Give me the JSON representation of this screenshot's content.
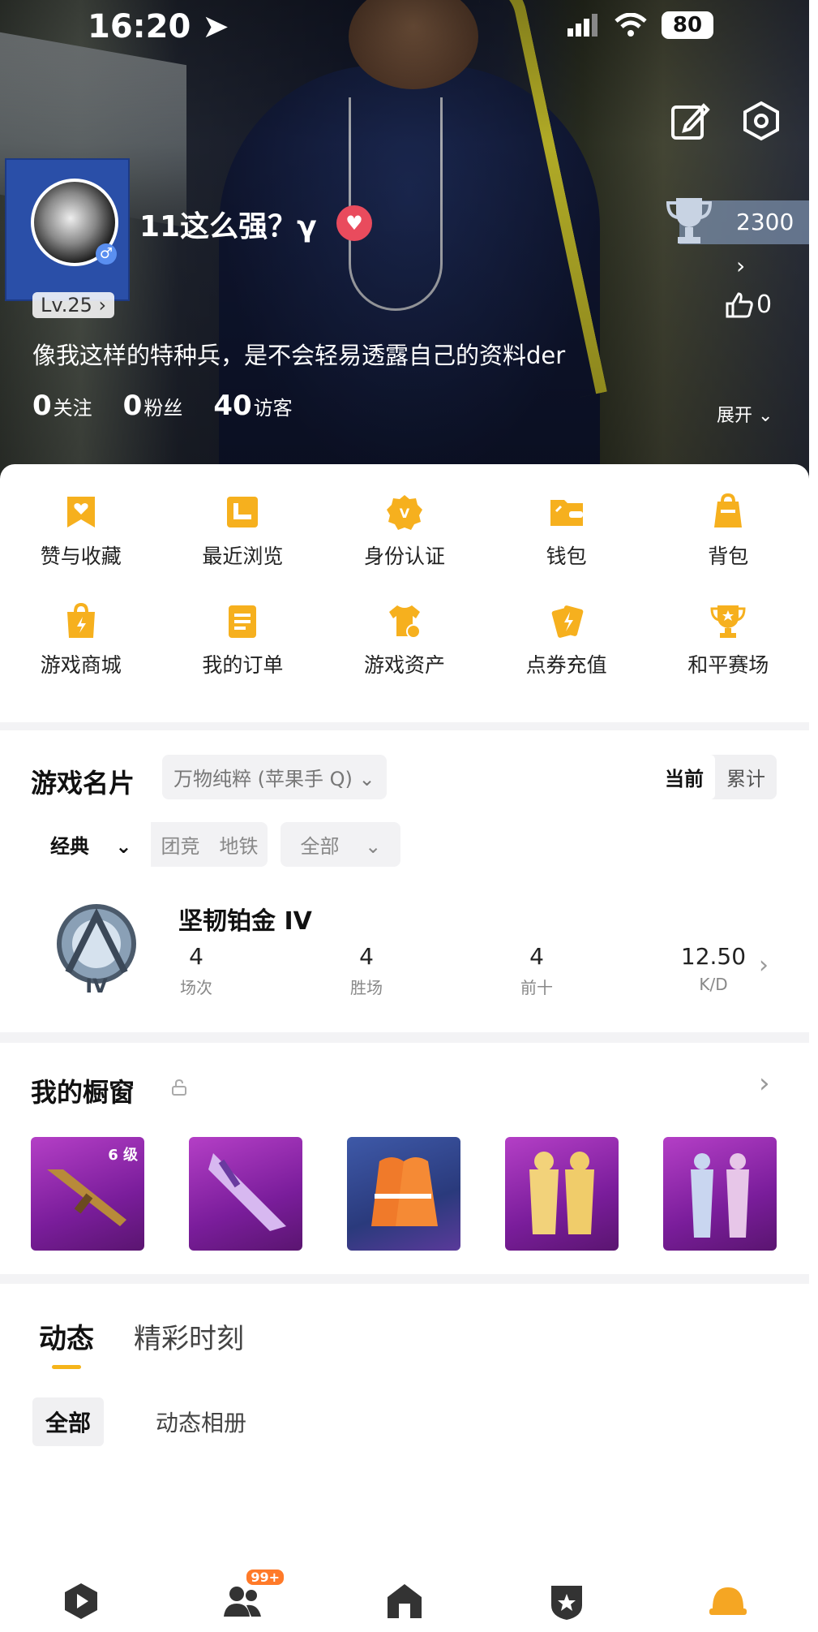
{
  "status_bar": {
    "time": "16:20",
    "battery": "80"
  },
  "profile": {
    "username": "11这么强？γ",
    "level": "Lv.25",
    "bio": "像我这样的特种兵，是不会轻易透露自己的资料der",
    "stats": [
      {
        "value": "0",
        "label": "关注"
      },
      {
        "value": "0",
        "label": "粉丝"
      },
      {
        "value": "40",
        "label": "访客"
      }
    ],
    "expand_label": "展开",
    "trophy_score": "2300",
    "likes": "0"
  },
  "menu": {
    "items": [
      {
        "label": "赞与收藏",
        "icon": "heart-bookmark-icon"
      },
      {
        "label": "最近浏览",
        "icon": "recent-browse-icon"
      },
      {
        "label": "身份认证",
        "icon": "verify-badge-icon"
      },
      {
        "label": "钱包",
        "icon": "wallet-icon"
      },
      {
        "label": "背包",
        "icon": "backpack-icon"
      },
      {
        "label": "游戏商城",
        "icon": "shopping-bag-icon"
      },
      {
        "label": "我的订单",
        "icon": "order-list-icon"
      },
      {
        "label": "游戏资产",
        "icon": "shirt-coin-icon"
      },
      {
        "label": "点券充值",
        "icon": "voucher-recharge-icon"
      },
      {
        "label": "和平赛场",
        "icon": "trophy-arena-icon"
      }
    ]
  },
  "game_card": {
    "title": "游戏名片",
    "server": "万物纯粹 (苹果手 Q)",
    "toggle": [
      "当前",
      "累计"
    ],
    "mode_main": "经典",
    "modes": [
      "团竞",
      "地铁"
    ],
    "filter": "全部",
    "rank_name": "坚韧铂金 IV",
    "rank_tier": "IV",
    "stats": [
      {
        "value": "4",
        "label": "场次"
      },
      {
        "value": "4",
        "label": "胜场"
      },
      {
        "value": "4",
        "label": "前十"
      },
      {
        "value": "12.50",
        "label": "K/D"
      }
    ]
  },
  "showcase": {
    "title": "我的橱窗",
    "items": [
      {
        "name": "rifle-skin-icon",
        "badge": "6 级"
      },
      {
        "name": "crossbow-skin-icon"
      },
      {
        "name": "orange-suit-icon"
      },
      {
        "name": "yellow-hazmat-suit-icon"
      },
      {
        "name": "mecha-suit-icon"
      }
    ]
  },
  "feed": {
    "tabs": [
      "动态",
      "精彩时刻"
    ],
    "chips": [
      "全部",
      "动态相册"
    ]
  },
  "bottom_nav": {
    "badge": "99+"
  },
  "colors": {
    "accent": "#f5b41a",
    "menu_icon": "#f6b01e",
    "nav_active": "#f5a623"
  }
}
